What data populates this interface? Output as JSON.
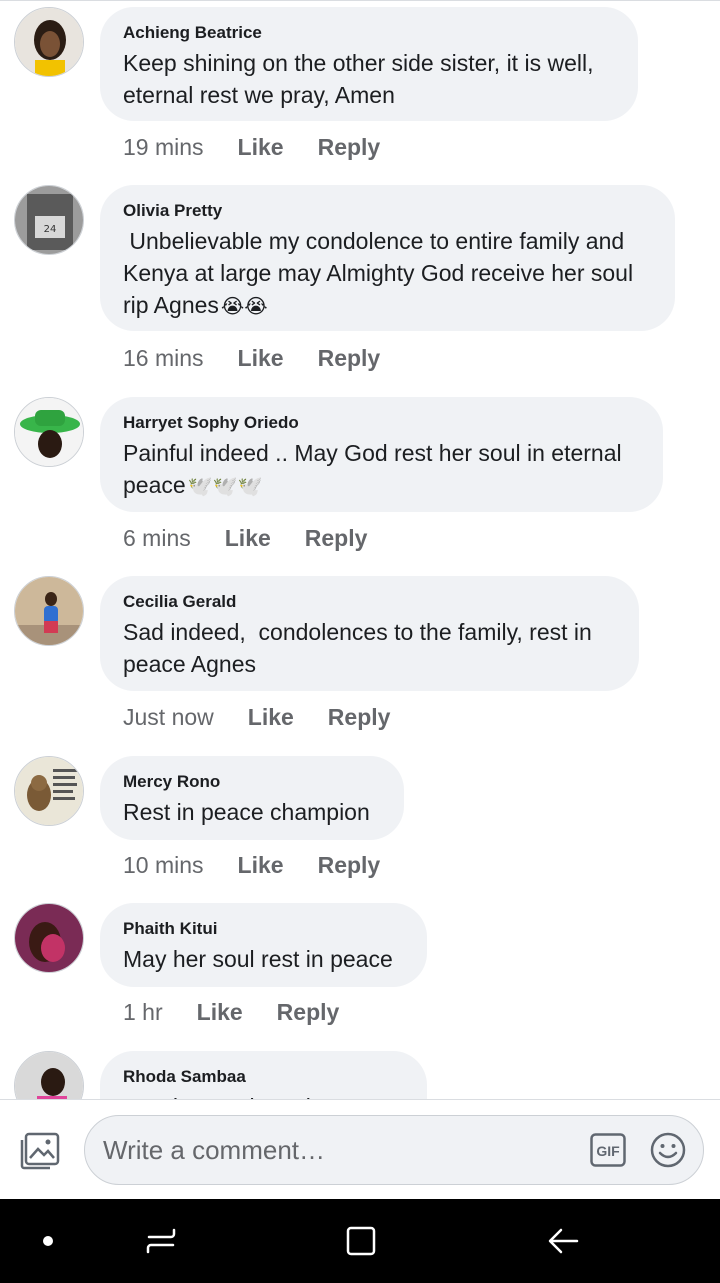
{
  "comments": [
    {
      "author": "Achieng Beatrice",
      "text": "Keep shining on the other side sister, it is well,\neternal rest we pray, Amen",
      "emoji": "",
      "time": "19 mins",
      "like": "Like",
      "reply": "Reply"
    },
    {
      "author": "Olivia Pretty",
      "text": " Unbelievable my condolence to entire family and\nKenya at large may Almighty God receive her soul\nrip Agnes",
      "emoji": "😭😭",
      "time": "16 mins",
      "like": "Like",
      "reply": "Reply"
    },
    {
      "author": "Harryet Sophy Oriedo",
      "text": "Painful indeed .. May God rest her soul in eternal\npeace",
      "emoji": "🕊️🕊️🕊️",
      "time": "6 mins",
      "like": "Like",
      "reply": "Reply"
    },
    {
      "author": "Cecilia Gerald",
      "text": "Sad indeed,  condolences to the family, rest in\npeace Agnes",
      "emoji": "",
      "time": "Just now",
      "like": "Like",
      "reply": "Reply"
    },
    {
      "author": "Mercy Rono",
      "text": "Rest in peace champion",
      "emoji": "",
      "time": "10 mins",
      "like": "Like",
      "reply": "Reply"
    },
    {
      "author": "Phaith Kitui",
      "text": "May her soul rest in peace",
      "emoji": "",
      "time": "1 hr",
      "like": "Like",
      "reply": "Reply"
    },
    {
      "author": "Rhoda Sambaa",
      "text": "May her soul rest in peace",
      "emoji": "",
      "time": "",
      "like": "",
      "reply": ""
    }
  ],
  "composer": {
    "placeholder": "Write a comment…",
    "gif_label": "GIF",
    "icons": [
      "photo-icon",
      "gif-icon",
      "emoji-icon"
    ]
  },
  "navbar": {
    "icons": [
      "dot-icon",
      "recents-icon",
      "home-icon",
      "back-icon"
    ]
  },
  "colors": {
    "bubble": "#f0f2f5",
    "meta": "#65676b",
    "text": "#1c1e21",
    "navbar": "#000000"
  }
}
